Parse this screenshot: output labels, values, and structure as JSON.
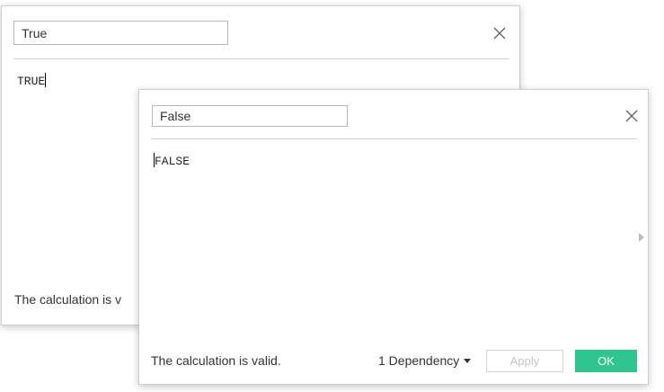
{
  "dialog_true": {
    "name_value": "True",
    "formula": "TRUE",
    "status": "The calculation is v"
  },
  "dialog_false": {
    "name_value": "False",
    "formula": "FALSE",
    "status": "The calculation is valid.",
    "dependency_label": "1 Dependency",
    "apply_label": "Apply",
    "ok_label": "OK"
  },
  "icons": {
    "close": "close-icon",
    "dropdown": "chevron-down-icon",
    "scroll": "scroll-right-arrow-icon"
  },
  "colors": {
    "ok_button": "#2ec68e",
    "apply_disabled_text": "#c4c4c4"
  }
}
